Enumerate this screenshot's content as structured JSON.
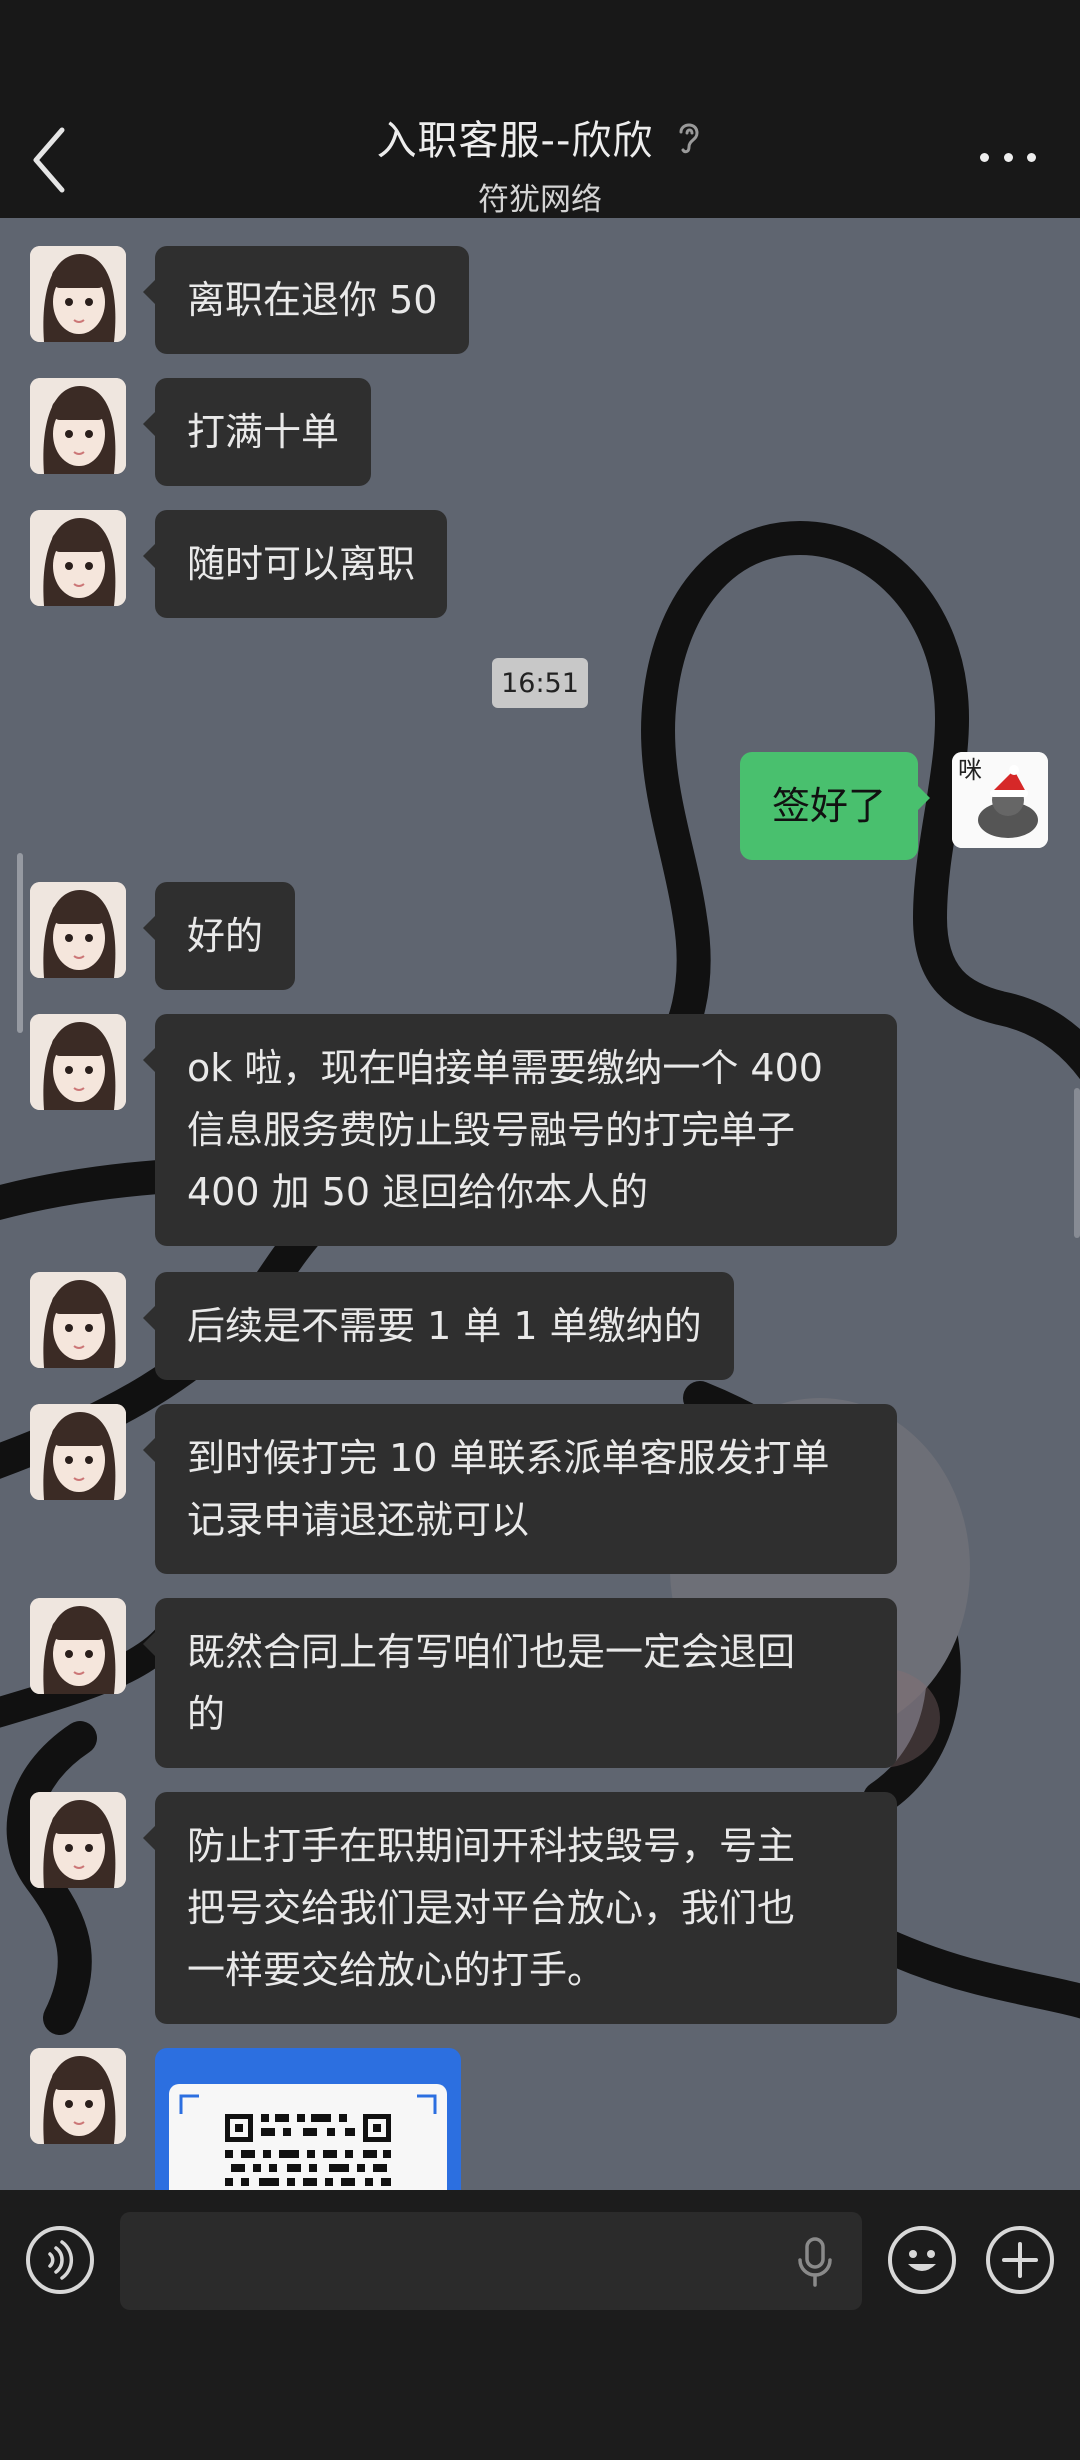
{
  "header": {
    "title": "入职客服--欣欣",
    "subtitle": "符犹网络",
    "back_icon": "chevron-left-icon",
    "ear_icon": "ear-icon",
    "more_icon": "more-dots-icon"
  },
  "timestamp": "16:51",
  "messages": [
    {
      "from": "agent",
      "text": "离职在退你 50"
    },
    {
      "from": "agent",
      "text": "打满十单"
    },
    {
      "from": "agent",
      "text": "随时可以离职"
    },
    {
      "from": "me",
      "text": "签好了"
    },
    {
      "from": "agent",
      "text": "好的"
    },
    {
      "from": "agent",
      "lines": [
        "ok 啦，现在咱接单需要缴纳一个 400",
        "信息服务费防止毁号融号的打完单子",
        "400 加 50 退回给你本人的"
      ]
    },
    {
      "from": "agent",
      "text": "后续是不需要 1 单 1 单缴纳的"
    },
    {
      "from": "agent",
      "lines": [
        "到时候打完 10 单联系派单客服发打单",
        "记录申请退还就可以"
      ]
    },
    {
      "from": "agent",
      "lines": [
        "既然合同上有写咱们也是一定会退回",
        "的"
      ]
    },
    {
      "from": "agent",
      "lines": [
        "防止打手在职期间开科技毁号，号主",
        "把号交给我们是对平台放心，我们也",
        "一样要交给放心的打手。"
      ]
    },
    {
      "from": "agent",
      "type": "qr-code-card"
    }
  ],
  "my_avatar_text": "咪",
  "input": {
    "placeholder": "",
    "voice_icon": "voice-icon",
    "mic_icon": "microphone-icon",
    "emoji_icon": "emoji-icon",
    "plus_icon": "plus-icon"
  },
  "colors": {
    "chat_bg": "#5f6570",
    "bubble_in": "#2f2f2f",
    "bubble_out": "#49c06e",
    "header_bg": "#181818"
  }
}
